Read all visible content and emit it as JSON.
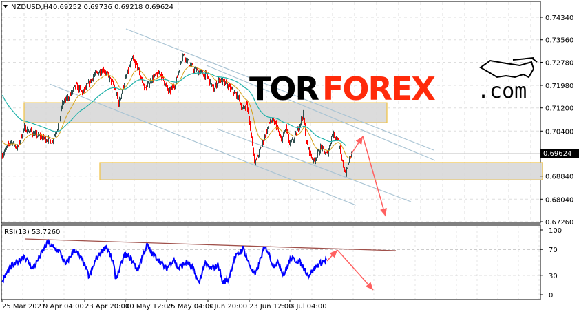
{
  "header": {
    "symbol": "NZDUSD,H4",
    "ohlc": "0.69252 0.69736 0.69218 0.69624"
  },
  "logo": {
    "part1": "TOR",
    "part2": "FOREX",
    "part3": ".com"
  },
  "colors": {
    "bull": "#2f4f4f",
    "bear": "#ff0000",
    "ma_fast": "#d4a017",
    "ma_slow": "#20b2aa",
    "zone_border": "#f0c040",
    "zone_fill": "#d8d8d8",
    "channel": "#a9c4d4",
    "arrow": "#ff6060",
    "rsi": "#0000ff",
    "rsi_trend": "#a0504a"
  },
  "chart_data": [
    {
      "type": "candlestick",
      "title": "NZDUSD,H4",
      "ylim": [
        0.6726,
        0.7434
      ],
      "y_ticks": [
        "0.74340",
        "0.73560",
        "0.72780",
        "0.71980",
        "0.71200",
        "0.70400",
        "0.68840",
        "0.68040",
        "0.67260"
      ],
      "current_price": "0.69624",
      "close_keypoints": [
        [
          0,
          0.6957
        ],
        [
          12,
          0.7005
        ],
        [
          22,
          0.6981
        ],
        [
          32,
          0.7053
        ],
        [
          47,
          0.7029
        ],
        [
          72,
          0.7005
        ],
        [
          82,
          0.7065
        ],
        [
          87,
          0.7136
        ],
        [
          97,
          0.716
        ],
        [
          107,
          0.7196
        ],
        [
          117,
          0.7172
        ],
        [
          132,
          0.7231
        ],
        [
          147,
          0.7255
        ],
        [
          162,
          0.7196
        ],
        [
          169,
          0.7136
        ],
        [
          177,
          0.7208
        ],
        [
          189,
          0.7291
        ],
        [
          197,
          0.7255
        ],
        [
          207,
          0.7184
        ],
        [
          217,
          0.722
        ],
        [
          229,
          0.7243
        ],
        [
          242,
          0.7172
        ],
        [
          252,
          0.7208
        ],
        [
          262,
          0.7308
        ],
        [
          277,
          0.7255
        ],
        [
          297,
          0.7231
        ],
        [
          307,
          0.7184
        ],
        [
          315,
          0.722
        ],
        [
          327,
          0.7196
        ],
        [
          342,
          0.716
        ],
        [
          349,
          0.7112
        ],
        [
          355,
          0.7136
        ],
        [
          362,
          0.7017
        ],
        [
          367,
          0.6926
        ],
        [
          377,
          0.6993
        ],
        [
          389,
          0.7076
        ],
        [
          397,
          0.7065
        ],
        [
          405,
          0.7005
        ],
        [
          412,
          0.7053
        ],
        [
          417,
          0.6993
        ],
        [
          425,
          0.7017
        ],
        [
          437,
          0.71
        ],
        [
          442,
          0.6993
        ],
        [
          452,
          0.6933
        ],
        [
          462,
          0.6981
        ],
        [
          472,
          0.6957
        ],
        [
          479,
          0.7029
        ],
        [
          487,
          0.7017
        ],
        [
          492,
          0.6945
        ],
        [
          499,
          0.689
        ],
        [
          503,
          0.6935
        ],
        [
          507,
          0.69624
        ]
      ],
      "moving_averages": [
        "fast MA (orange)",
        "slow MA (teal)"
      ],
      "zones": [
        [
          0.7069,
          0.7138
        ],
        [
          0.6871,
          0.6931
        ]
      ]
    },
    {
      "type": "line",
      "title": "RSI(13) 53.7260",
      "label": "RSI(13)",
      "value": "53.7260",
      "ylim": [
        0,
        100
      ],
      "y_ticks": [
        "100",
        "70",
        "30",
        "0"
      ],
      "x_ticks": [
        "25 Mar 2021",
        "9 Apr 04:00",
        "23 Apr 20:00",
        "10 May 12:00",
        "25 May 04:00",
        "8 Jun 20:00",
        "23 Jun 12:00",
        "8 Jul 04:00"
      ],
      "keypoints": [
        [
          0,
          20
        ],
        [
          12,
          40
        ],
        [
          27,
          51
        ],
        [
          37,
          60
        ],
        [
          52,
          40
        ],
        [
          77,
          81
        ],
        [
          87,
          72
        ],
        [
          97,
          67
        ],
        [
          107,
          46
        ],
        [
          122,
          70
        ],
        [
          137,
          51
        ],
        [
          147,
          27
        ],
        [
          159,
          56
        ],
        [
          175,
          76
        ],
        [
          187,
          51
        ],
        [
          192,
          24
        ],
        [
          207,
          62
        ],
        [
          217,
          56
        ],
        [
          229,
          38
        ],
        [
          237,
          60
        ],
        [
          245,
          77
        ],
        [
          252,
          64
        ],
        [
          262,
          56
        ],
        [
          277,
          40
        ],
        [
          290,
          56
        ],
        [
          297,
          40
        ],
        [
          312,
          51
        ],
        [
          322,
          40
        ],
        [
          332,
          17
        ],
        [
          342,
          48
        ],
        [
          352,
          40
        ],
        [
          365,
          46
        ],
        [
          372,
          19
        ],
        [
          382,
          24
        ],
        [
          392,
          56
        ],
        [
          407,
          72
        ],
        [
          417,
          46
        ],
        [
          427,
          30
        ],
        [
          442,
          72
        ],
        [
          447,
          70
        ],
        [
          457,
          46
        ],
        [
          467,
          49
        ],
        [
          475,
          30
        ],
        [
          487,
          56
        ],
        [
          502,
          51
        ],
        [
          517,
          30
        ],
        [
          532,
          46
        ],
        [
          547,
          53.726
        ]
      ]
    }
  ]
}
